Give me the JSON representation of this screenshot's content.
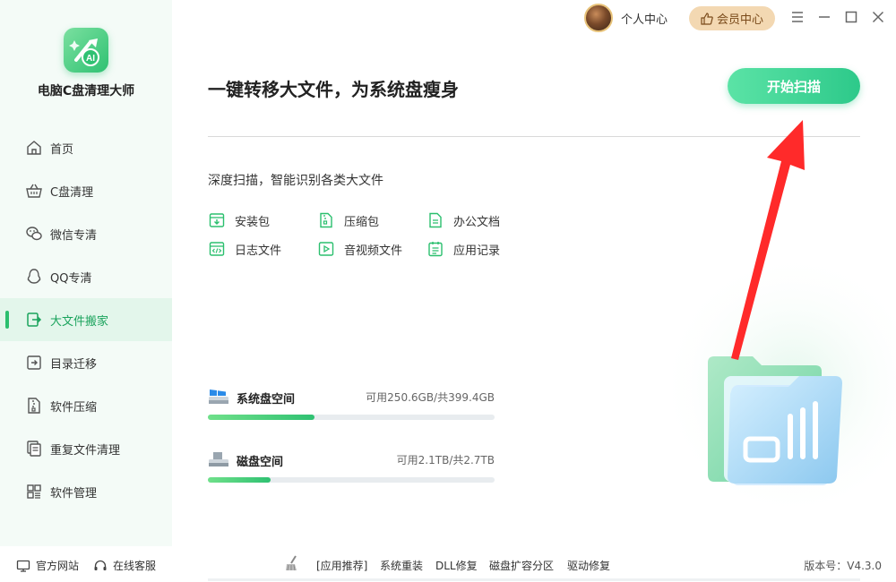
{
  "app": {
    "name": "电脑C盘清理大师"
  },
  "topbar": {
    "personal_center": "个人中心",
    "vip_center": "会员中心"
  },
  "sidebar": {
    "items": [
      {
        "label": "首页",
        "icon": "home-icon"
      },
      {
        "label": "C盘清理",
        "icon": "basket-icon"
      },
      {
        "label": "微信专清",
        "icon": "wechat-icon"
      },
      {
        "label": "QQ专清",
        "icon": "qq-icon"
      },
      {
        "label": "大文件搬家",
        "icon": "file-move-icon",
        "active": true
      },
      {
        "label": "目录迁移",
        "icon": "folder-migrate-icon"
      },
      {
        "label": "软件压缩",
        "icon": "zip-icon"
      },
      {
        "label": "重复文件清理",
        "icon": "duplicate-file-icon"
      },
      {
        "label": "软件管理",
        "icon": "apps-grid-icon"
      }
    ]
  },
  "main": {
    "headline": "一键转移大文件，为系统盘瘦身",
    "scan_button": "开始扫描",
    "subtitle": "深度扫描，智能识别各类大文件",
    "categories": [
      {
        "label": "安装包",
        "icon": "install-package-icon"
      },
      {
        "label": "压缩包",
        "icon": "archive-icon"
      },
      {
        "label": "办公文档",
        "icon": "document-icon"
      },
      {
        "label": "日志文件",
        "icon": "log-file-icon"
      },
      {
        "label": "音视频文件",
        "icon": "video-file-icon"
      },
      {
        "label": "应用记录",
        "icon": "app-record-icon"
      }
    ],
    "disks": [
      {
        "name": "系统盘空间",
        "info": "可用250.6GB/共399.4GB",
        "used_fraction": 0.373
      },
      {
        "name": "磁盘空间",
        "info": "可用2.1TB/共2.7TB",
        "used_fraction": 0.22
      }
    ]
  },
  "footer": {
    "official_site": "官方网站",
    "online_service": "在线客服",
    "recommend": "[应用推荐]",
    "links": [
      "系统重装",
      "DLL修复",
      "磁盘扩容分区",
      "驱动修复"
    ],
    "version": "版本号：V4.3.0"
  },
  "colors": {
    "accent": "#2bbf6e",
    "arrow": "#ff2a2a",
    "vip": "#f3d8b2"
  }
}
